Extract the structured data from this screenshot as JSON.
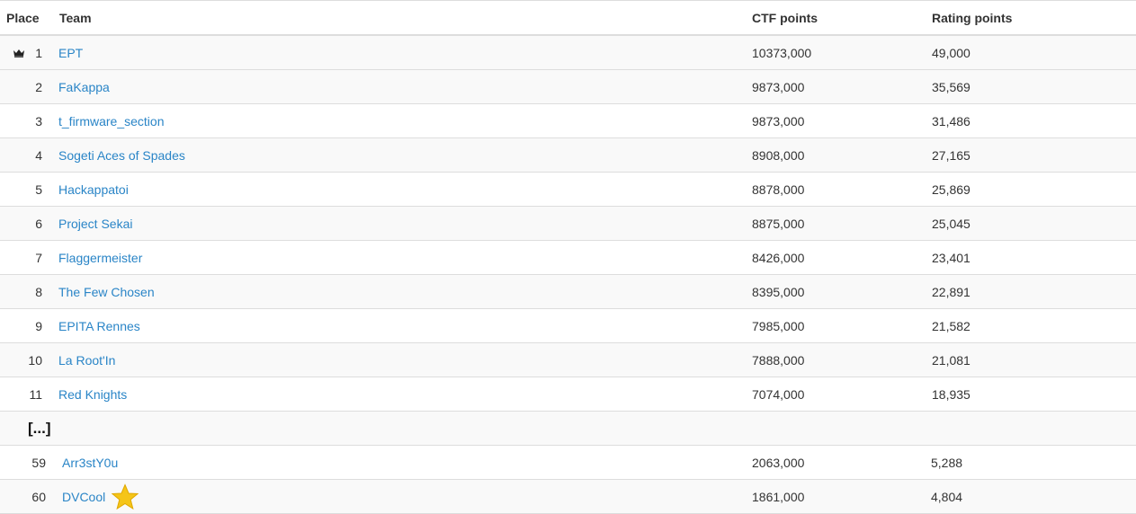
{
  "headers": {
    "place": "Place",
    "team": "Team",
    "ctf_points": "CTF points",
    "rating_points": "Rating points"
  },
  "rows": [
    {
      "place": "1",
      "team": "EPT",
      "ctf": "10373,000",
      "rating": "49,000",
      "icon": "crown-icon"
    },
    {
      "place": "2",
      "team": "FaKappa",
      "ctf": "9873,000",
      "rating": "35,569"
    },
    {
      "place": "3",
      "team": "t_firmware_section",
      "ctf": "9873,000",
      "rating": "31,486"
    },
    {
      "place": "4",
      "team": "Sogeti Aces of Spades",
      "ctf": "8908,000",
      "rating": "27,165"
    },
    {
      "place": "5",
      "team": "Hackappatoi",
      "ctf": "8878,000",
      "rating": "25,869"
    },
    {
      "place": "6",
      "team": "Project Sekai",
      "ctf": "8875,000",
      "rating": "25,045"
    },
    {
      "place": "7",
      "team": "Flaggermeister",
      "ctf": "8426,000",
      "rating": "23,401"
    },
    {
      "place": "8",
      "team": "The Few Chosen",
      "ctf": "8395,000",
      "rating": "22,891"
    },
    {
      "place": "9",
      "team": "EPITA Rennes",
      "ctf": "7985,000",
      "rating": "21,582"
    },
    {
      "place": "10",
      "team": "La Root'In",
      "ctf": "7888,000",
      "rating": "21,081"
    },
    {
      "place": "11",
      "team": "Red Knights",
      "ctf": "7074,000",
      "rating": "18,935"
    }
  ],
  "ellipsis": "[...]",
  "tail_rows": [
    {
      "place": "59",
      "team": "Arr3stY0u",
      "ctf": "2063,000",
      "rating": "5,288"
    },
    {
      "place": "60",
      "team": "DVCool",
      "ctf": "1861,000",
      "rating": "4,804",
      "icon": "star-icon",
      "icon_color": "#f5c518"
    }
  ],
  "colors": {
    "link": "#2a85c7",
    "row_alt": "#f9f9f9",
    "border": "#dddddd",
    "star": "#f5c518"
  }
}
